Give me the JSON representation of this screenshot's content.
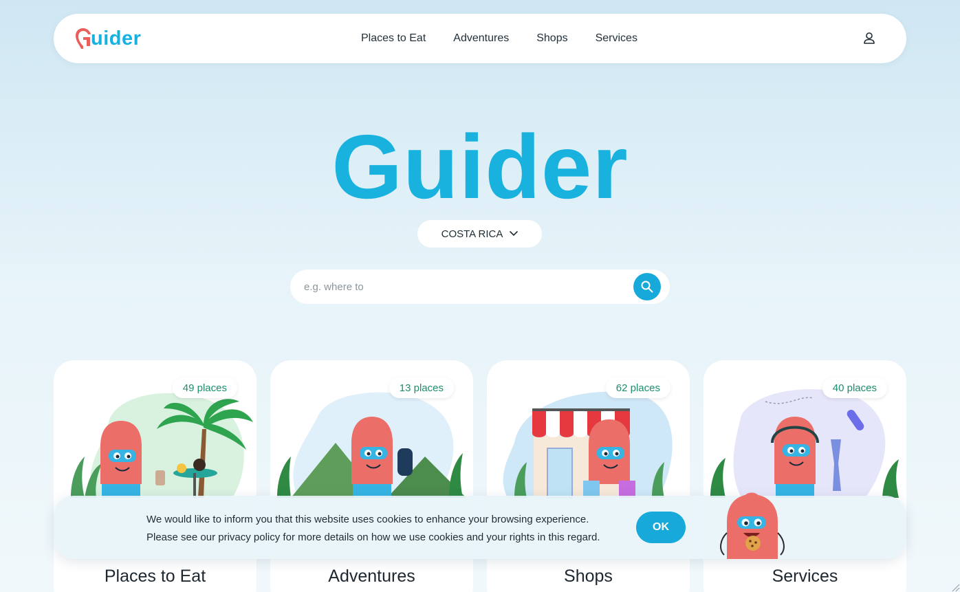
{
  "brand": {
    "name": "Guider",
    "logo_letter": "G",
    "logo_rest": "uider"
  },
  "nav": {
    "links": [
      "Places to Eat",
      "Adventures",
      "Shops",
      "Services"
    ],
    "user_icon": "user-icon"
  },
  "hero": {
    "title": "Guider",
    "country": "COSTA RICA",
    "search_placeholder": "e.g. where to"
  },
  "categories": [
    {
      "label": "Places to Eat",
      "count": "49 places"
    },
    {
      "label": "Adventures",
      "count": "13 places"
    },
    {
      "label": "Shops",
      "count": "62 places"
    },
    {
      "label": "Services",
      "count": "40 places"
    }
  ],
  "cookie": {
    "line1": "We would like to inform you that this website uses cookies to enhance your browsing experience.",
    "line2": "Please see our privacy policy for more details on how we use cookies and your rights in this regard.",
    "ok": "OK"
  },
  "colors": {
    "accent": "#16a9d9",
    "title": "#19b2df",
    "badge_text": "#1d8d6d",
    "logo_red": "#e85f5c",
    "mascot": "#ec6e68"
  }
}
